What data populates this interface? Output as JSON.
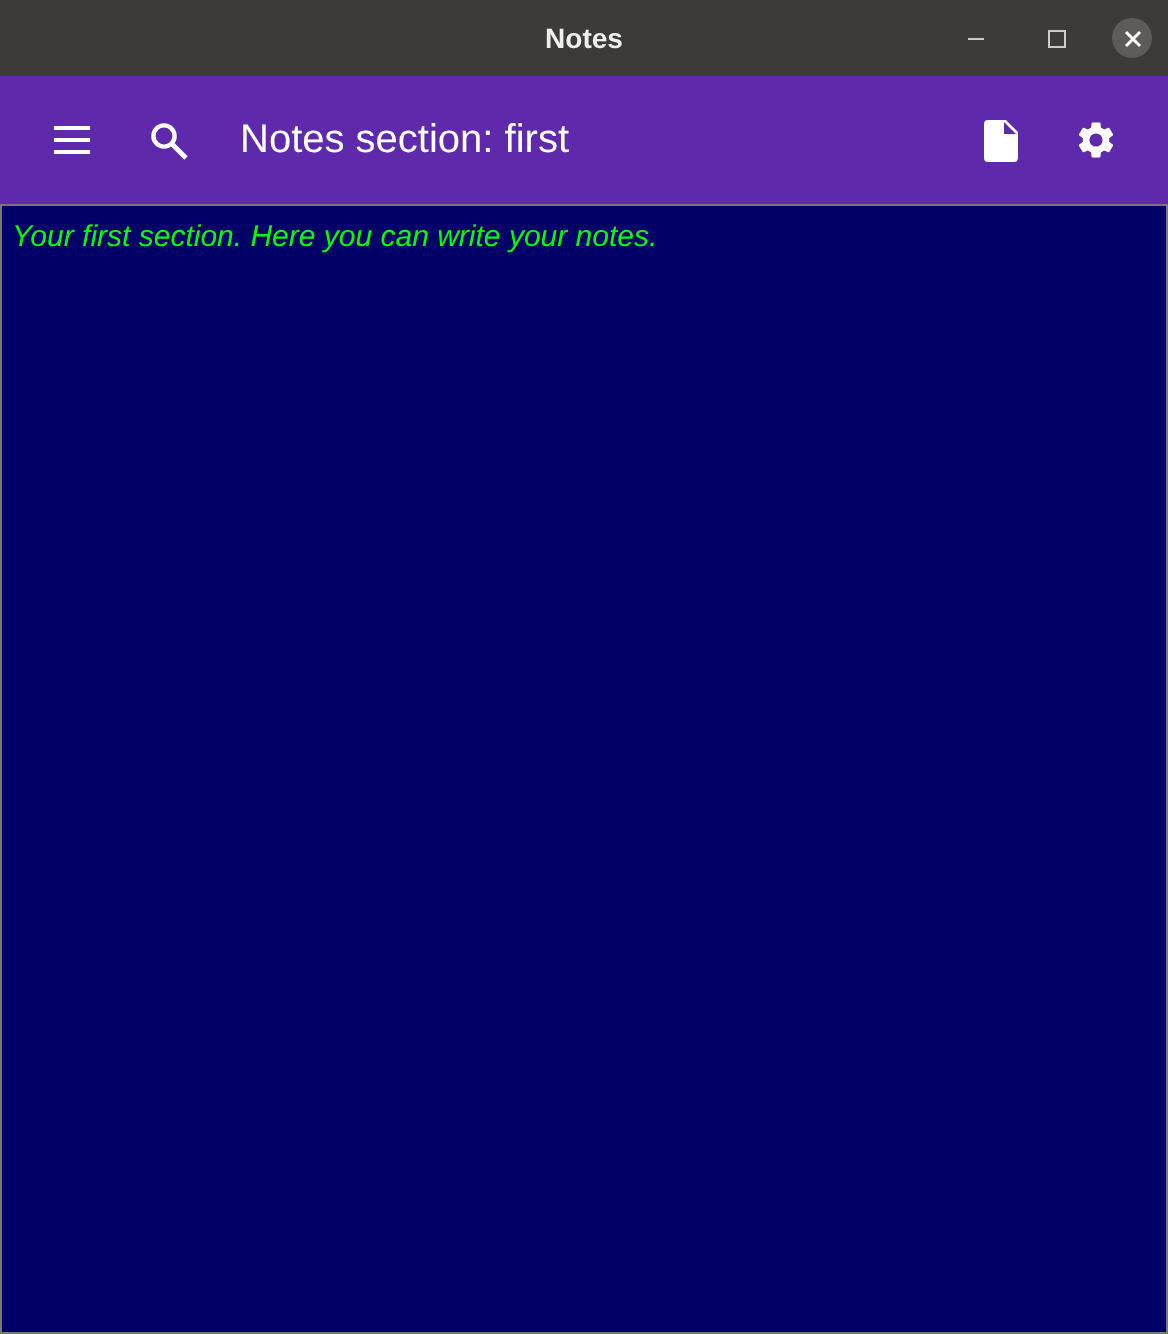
{
  "window": {
    "title": "Notes"
  },
  "toolbar": {
    "title": "Notes section: first"
  },
  "editor": {
    "value": "Your first section. Here you can write your notes."
  }
}
